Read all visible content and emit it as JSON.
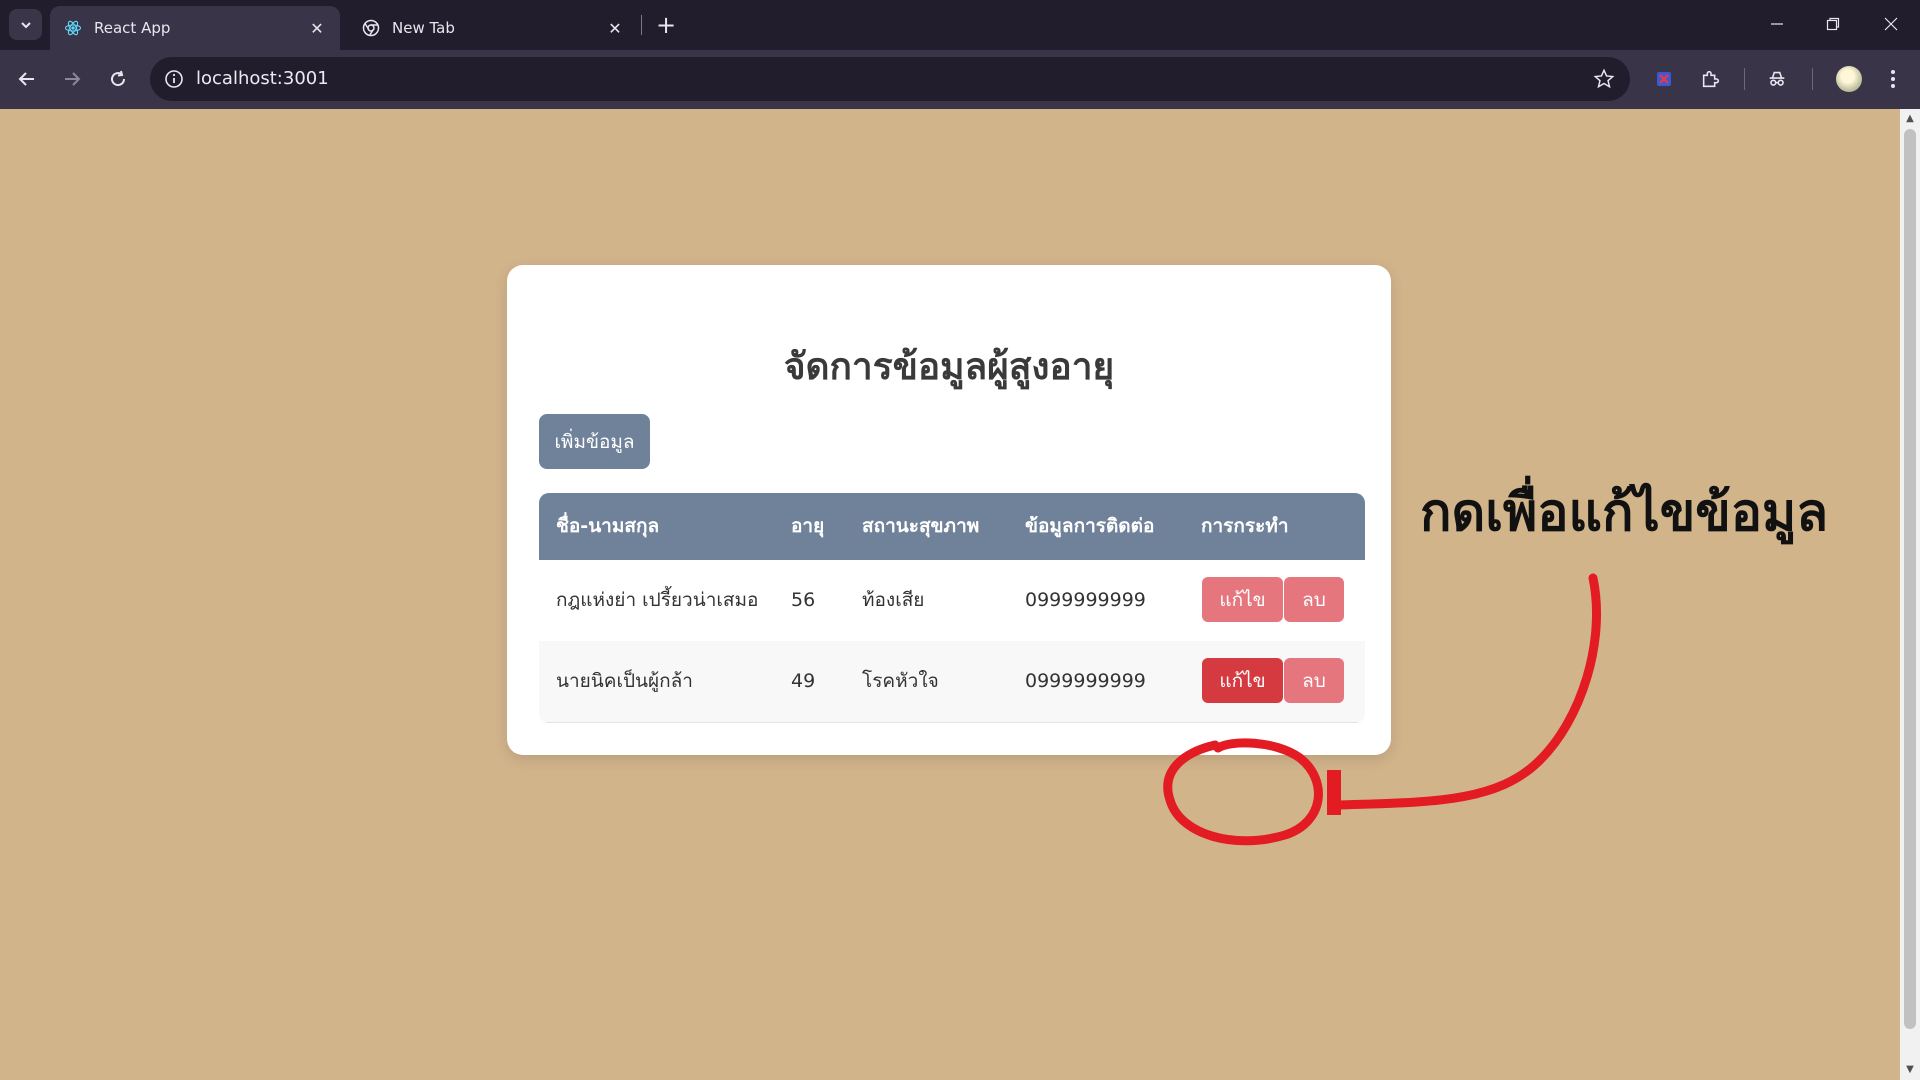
{
  "browser": {
    "tabs": [
      {
        "title": "React App",
        "active": true,
        "icon": "react-icon"
      },
      {
        "title": "New Tab",
        "active": false,
        "icon": "chrome-icon"
      }
    ],
    "url": "localhost:3001"
  },
  "app": {
    "title": "จัดการข้อมูลผู้สูงอายุ",
    "add_button": "เพิ่มข้อมูล",
    "columns": [
      "ชื่อ-นามสกุล",
      "อายุ",
      "สถานะสุขภาพ",
      "ข้อมูลการติดต่อ",
      "การกระทำ"
    ],
    "rows": [
      {
        "name": "กฎแห่งย่า เปรี้ยวน่าเสมอ",
        "age": "56",
        "health": "ท้องเสีย",
        "contact": "0999999999",
        "edit": "แก้ไข",
        "delete": "ลบ"
      },
      {
        "name": "นายนิคเป็นผู้กล้า",
        "age": "49",
        "health": "โรคหัวใจ",
        "contact": "0999999999",
        "edit": "แก้ไข",
        "delete": "ลบ"
      }
    ]
  },
  "annotation": {
    "text": "กดเพื่อแก้ไขข้อมูล",
    "color": "#e31b23"
  },
  "colors": {
    "page_background": "#d2b48b",
    "header_background": "#70819a",
    "button_red": "#e5767d",
    "button_red_active": "#d63a41"
  }
}
